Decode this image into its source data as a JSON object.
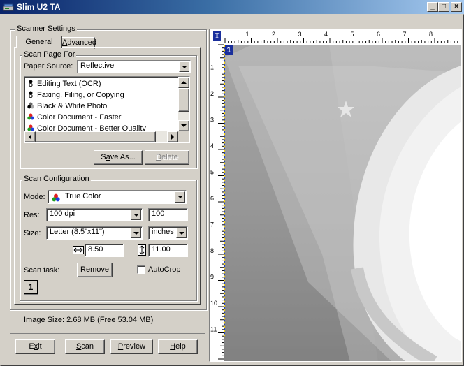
{
  "window": {
    "title": "Slim U2 TA",
    "min": "_",
    "max": "□",
    "close": "×"
  },
  "settings": {
    "group_label": "Scanner Settings",
    "tabs": [
      "General",
      "Advanced"
    ],
    "scan_page_for": {
      "label": "Scan Page For",
      "paper_source_label": "Paper Source:",
      "paper_source_value": "Reflective",
      "items": [
        {
          "label": "Editing Text (OCR)",
          "icon": "text-bw-icon"
        },
        {
          "label": "Faxing, Filing, or Copying",
          "icon": "text-bw-icon"
        },
        {
          "label": "Black & White Photo",
          "icon": "grayscale-icon"
        },
        {
          "label": "Color Document - Faster",
          "icon": "color-icon"
        },
        {
          "label": "Color Document - Better Quality",
          "icon": "color-icon"
        }
      ],
      "save_as": "Save As...",
      "delete": "Delete"
    },
    "scan_config": {
      "label": "Scan Configuration",
      "mode_label": "Mode:",
      "mode_value": "True Color",
      "res_label": "Res:",
      "res_value": "100 dpi",
      "res_custom": "100",
      "size_label": "Size:",
      "size_value": "Letter (8.5\"x11\")",
      "units_value": "inches",
      "width_value": "8.50",
      "height_value": "11.00",
      "scan_task_label": "Scan task:",
      "remove": "Remove",
      "autocrop": "AutoCrop",
      "task_number": "1"
    },
    "image_size": "Image Size: 2.68 MB (Free 53.04 MB)"
  },
  "buttons": {
    "exit": "Exit",
    "scan": "Scan",
    "preview": "Preview",
    "help": "Help"
  },
  "preview": {
    "ruler_h": [
      "1",
      "2",
      "3",
      "4",
      "5",
      "6",
      "7",
      "8"
    ],
    "ruler_v": [
      "1",
      "2",
      "3",
      "4",
      "5",
      "6",
      "7",
      "8",
      "9",
      "10",
      "11"
    ],
    "corner_icon": "T",
    "frame_number": "1"
  }
}
